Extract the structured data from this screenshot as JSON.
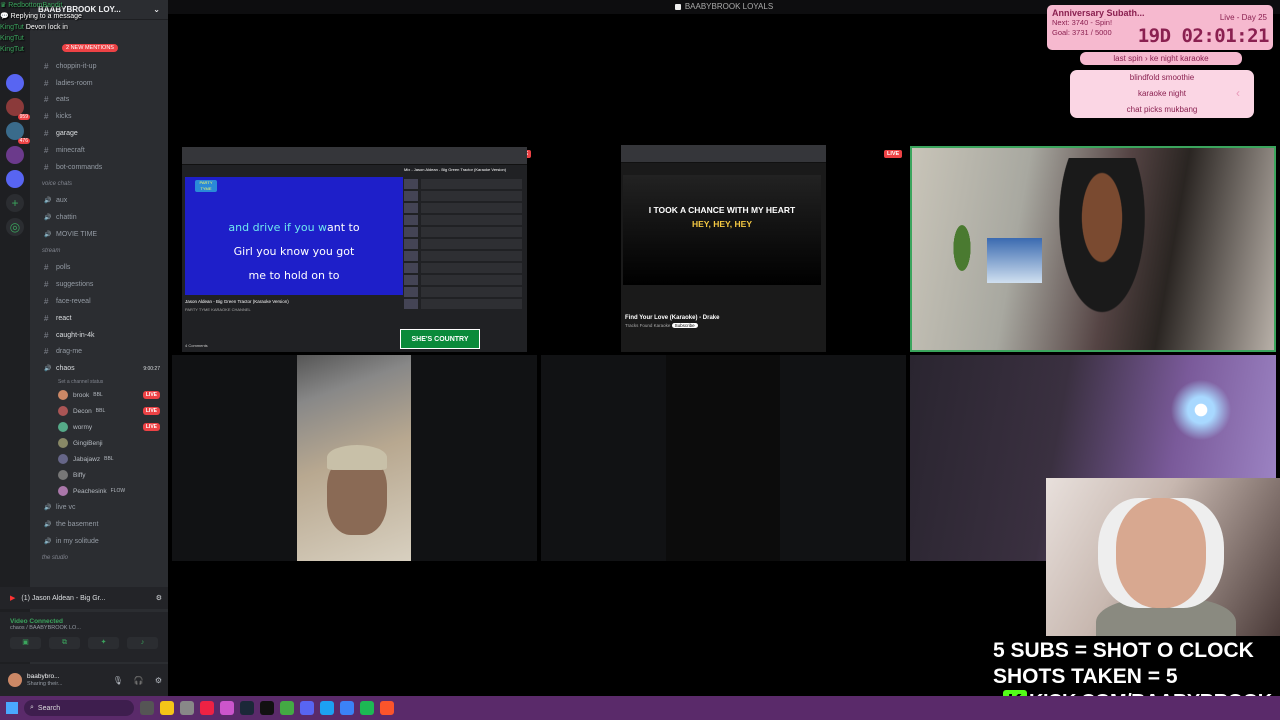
{
  "window_title": "BAABYBROOK LOYALS",
  "chat_overlay": [
    {
      "user": "RedbottomBandit",
      "text": "",
      "color": "#3ba55d"
    },
    {
      "user": "",
      "text": "Replying to a message",
      "color": "#ffffff"
    },
    {
      "user": "KingTut",
      "text": "Devon lock in",
      "color": "#3ba55d"
    },
    {
      "user": "KingTut",
      "text": "",
      "color": "#3ba55d"
    },
    {
      "user": "KingTut",
      "text": "",
      "color": "#3ba55d"
    }
  ],
  "mentions_badge": "2 NEW MENTIONS",
  "server": {
    "name": "BAABYBROOK LOY..."
  },
  "rail_badges": [
    "959",
    "476"
  ],
  "channels": [
    {
      "name": "choppin-it-up",
      "type": "text"
    },
    {
      "name": "ladies-room",
      "type": "text"
    },
    {
      "name": "eats",
      "type": "text"
    },
    {
      "name": "kicks",
      "type": "text"
    },
    {
      "name": "garage",
      "type": "text",
      "active": true
    },
    {
      "name": "minecraft",
      "type": "text"
    },
    {
      "name": "bot-commands",
      "type": "text"
    },
    {
      "name": "voice chats",
      "type": "category"
    },
    {
      "name": "aux",
      "type": "voice"
    },
    {
      "name": "chattin",
      "type": "voice"
    },
    {
      "name": "MOVIE TIME",
      "type": "voice"
    },
    {
      "name": "stream",
      "type": "category"
    },
    {
      "name": "polls",
      "type": "text"
    },
    {
      "name": "suggestions",
      "type": "text"
    },
    {
      "name": "face-reveal",
      "type": "text"
    },
    {
      "name": "react",
      "type": "text",
      "active": true
    },
    {
      "name": "caught-in-4k",
      "type": "text",
      "active": true
    },
    {
      "name": "drag-me",
      "type": "text"
    },
    {
      "name": "chaos",
      "type": "voice",
      "active": true,
      "timer": "9:00:27"
    }
  ],
  "channel_status": "Set a channel status",
  "voice_members": [
    {
      "name": "brook",
      "tag": "BBL",
      "live": true
    },
    {
      "name": "Decon",
      "tag": "BBL",
      "live": true
    },
    {
      "name": "wormy",
      "tag": "",
      "live": true
    },
    {
      "name": "GingiBenji",
      "tag": "",
      "live": false
    },
    {
      "name": "Jabajawz",
      "tag": "BBL",
      "live": false
    },
    {
      "name": "Biffy",
      "tag": "",
      "live": false
    },
    {
      "name": "Peachesink",
      "tag": "FLOW",
      "live": false
    }
  ],
  "channels_after": [
    {
      "name": "live vc",
      "type": "voice"
    },
    {
      "name": "the basement",
      "type": "voice"
    },
    {
      "name": "in my solitude",
      "type": "voice"
    },
    {
      "name": "the studio",
      "type": "category"
    }
  ],
  "live_label": "LIVE",
  "now_playing": "(1) Jason Aldean - Big Gr...",
  "voice_connected": {
    "status": "Video Connected",
    "sub": "chaos / BAABYBROOK LO..."
  },
  "user": {
    "name": "baabybro...",
    "status": "Sharing their..."
  },
  "screen1": {
    "lyrics": [
      "and drive if you want to",
      "Girl you know you got",
      "me to hold on to"
    ],
    "lyric_highlight": "and drive if you w",
    "lyric_rest": "ant to",
    "video_title": "Jason Aldean - Big Green Tractor (Karaoke Version)",
    "channel": "PARTY TYME KARAOKE CHANNEL",
    "comments": "4 Comments",
    "playlist_title": "Mix - Jason Aldean - Big Green Tractor (Karaoke Version)",
    "banner": "SHE'S COUNTRY"
  },
  "screen2": {
    "lyric_line1": "I TOOK A CHANCE WITH MY HEART",
    "lyric_line2_a": "HEY, ",
    "lyric_line2_b": "HEY, HEY",
    "video_title": "Find Your Love (Karaoke) - Drake",
    "channel": "Tracks Found Karaoke",
    "subscribe": "Subscribe"
  },
  "subgoal": {
    "title": "Anniversary Subath...",
    "day": "Live - Day 25",
    "next": "Next: 3740 - Spin!",
    "goal": "Goal: 3731 / 5000",
    "timer": "19D 02:01:21"
  },
  "spin": {
    "last": "last spin",
    "current": "ke night karaoke",
    "options": [
      "blindfold smoothie",
      "karaoke night",
      "chat picks mukbang"
    ]
  },
  "shots": {
    "line1": "5 SUBS = SHOT O CLOCK",
    "line2": "SHOTS TAKEN = 5"
  },
  "kick_url": "KICK.COM/BAABYBROOK",
  "taskbar": {
    "search": "Search"
  }
}
